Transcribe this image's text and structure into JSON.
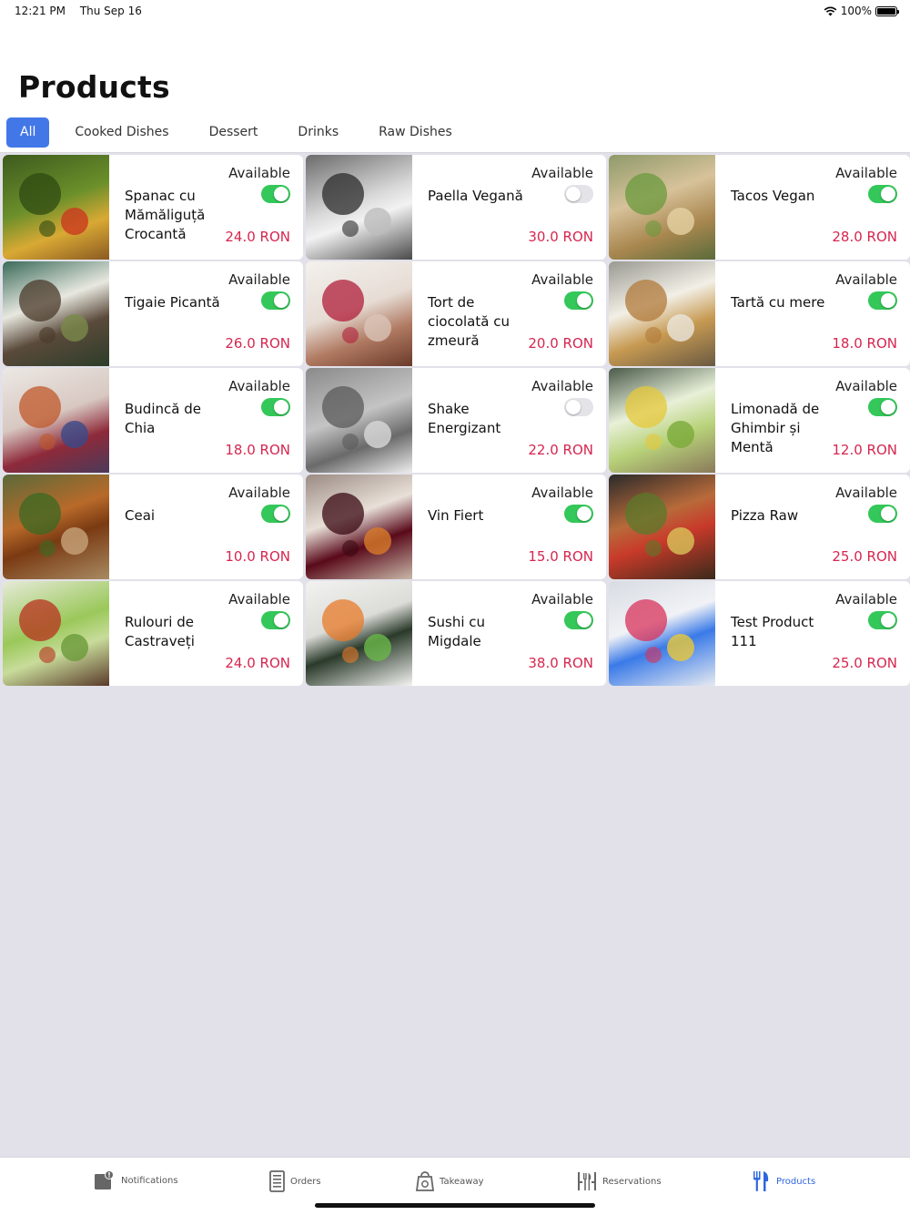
{
  "status": {
    "time": "12:21 PM",
    "date": "Thu Sep 16",
    "battery": "100%"
  },
  "page": {
    "title": "Products"
  },
  "tabs": [
    {
      "label": "All",
      "active": true
    },
    {
      "label": "Cooked Dishes",
      "active": false
    },
    {
      "label": "Dessert",
      "active": false
    },
    {
      "label": "Drinks",
      "active": false
    },
    {
      "label": "Raw Dishes",
      "active": false
    }
  ],
  "products": [
    {
      "name": "Spanac cu Mămăliguță Crocantă",
      "status": "Available",
      "available": true,
      "price": "24.0 RON",
      "photo": "spinach-polenta-photo"
    },
    {
      "name": "Paella Vegană",
      "status": "Available",
      "available": false,
      "price": "30.0 RON",
      "photo": "paella-photo"
    },
    {
      "name": "Tacos Vegan",
      "status": "Available",
      "available": true,
      "price": "28.0 RON",
      "photo": "tacos-photo"
    },
    {
      "name": "Tigaie Picantă",
      "status": "Available",
      "available": true,
      "price": "26.0 RON",
      "photo": "mushroom-pan-photo"
    },
    {
      "name": "Tort de ciocolată cu zmeură",
      "status": "Available",
      "available": true,
      "price": "20.0 RON",
      "photo": "chocolate-cake-photo"
    },
    {
      "name": "Tartă cu mere",
      "status": "Available",
      "available": true,
      "price": "18.0 RON",
      "photo": "apple-tart-photo"
    },
    {
      "name": "Budincă de Chia",
      "status": "Available",
      "available": true,
      "price": "18.0 RON",
      "photo": "chia-pudding-photo"
    },
    {
      "name": "Shake Energizant",
      "status": "Available",
      "available": false,
      "price": "22.0 RON",
      "photo": "shake-photo"
    },
    {
      "name": "Limonadă de Ghimbir și Mentă",
      "status": "Available",
      "available": true,
      "price": "12.0 RON",
      "photo": "lemonade-photo"
    },
    {
      "name": "Ceai",
      "status": "Available",
      "available": true,
      "price": "10.0 RON",
      "photo": "tea-photo"
    },
    {
      "name": "Vin Fiert",
      "status": "Available",
      "available": true,
      "price": "15.0 RON",
      "photo": "mulled-wine-photo"
    },
    {
      "name": "Pizza Raw",
      "status": "Available",
      "available": true,
      "price": "25.0 RON",
      "photo": "raw-pizza-photo"
    },
    {
      "name": "Rulouri de Castraveți",
      "status": "Available",
      "available": true,
      "price": "24.0 RON",
      "photo": "cucumber-rolls-photo"
    },
    {
      "name": "Sushi cu Migdale",
      "status": "Available",
      "available": true,
      "price": "38.0 RON",
      "photo": "sushi-photo"
    },
    {
      "name": "Test Product 111",
      "status": "Available",
      "available": true,
      "price": "25.0 RON",
      "photo": "cocktail-photo"
    }
  ],
  "tabbar": [
    {
      "label": "Notifications",
      "icon": "notifications-icon",
      "active": false
    },
    {
      "label": "Orders",
      "icon": "orders-icon",
      "active": false
    },
    {
      "label": "Takeaway",
      "icon": "takeaway-bag-icon",
      "active": false
    },
    {
      "label": "Reservations",
      "icon": "reservations-icon",
      "active": false
    },
    {
      "label": "Products",
      "icon": "products-icon",
      "active": true
    }
  ],
  "colors": {
    "accent": "#4277e8",
    "price": "#d6264f",
    "toggle_on": "#34c759",
    "toggle_off": "#e3e3e8",
    "background": "#e2e1ea",
    "tab_active": "#2f66e0"
  }
}
